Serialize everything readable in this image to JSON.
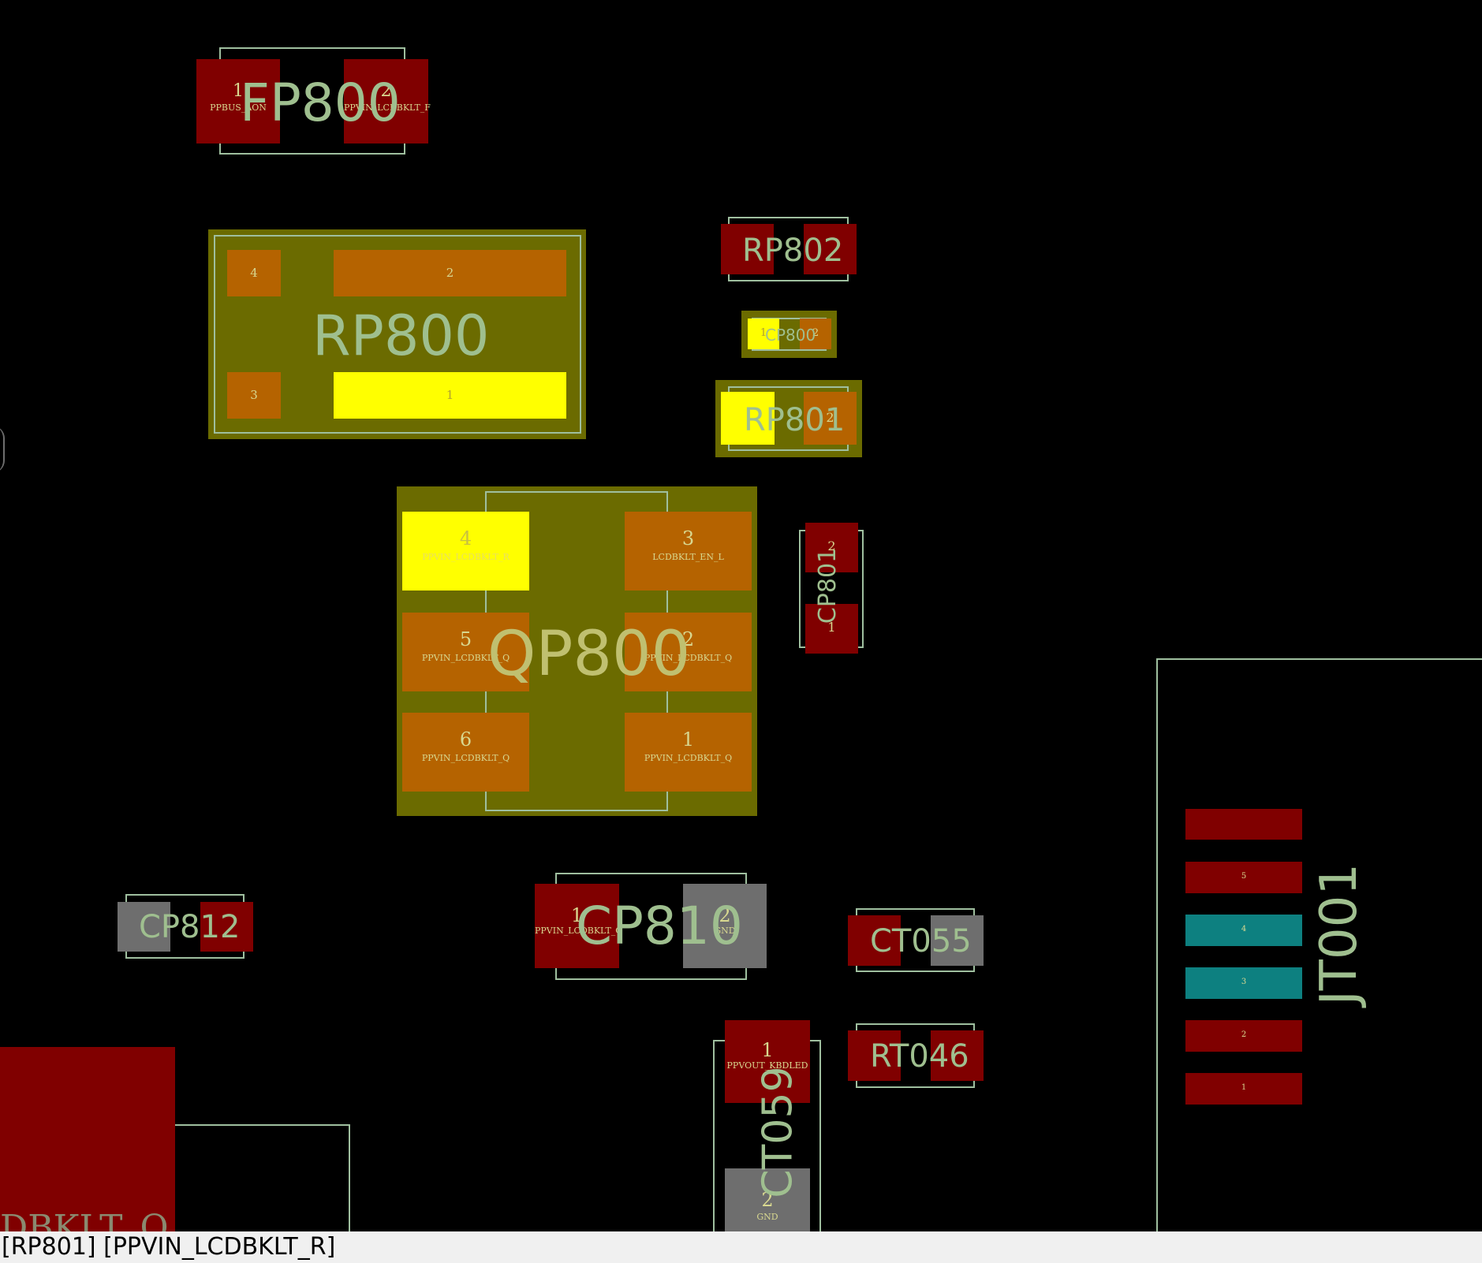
{
  "status_bar": {
    "text": "[RP801] [PPVIN_LCDBKLT_R]"
  },
  "colors": {
    "background": "#000000",
    "silkscreen": "#9fbf9f",
    "highlight": "#6b6b00",
    "pad_red": "#800000",
    "pad_orange": "#b56300",
    "pad_selected": "#ffff00",
    "pad_gnd": "#6e6e6e",
    "pad_teal": "#0d8080"
  },
  "components": {
    "fp800": {
      "ref": "FP800",
      "pins": [
        {
          "num": "1",
          "net": "PPBUS_AON"
        },
        {
          "num": "2",
          "net": "PPVIN_LCDBKLT_F"
        }
      ]
    },
    "rp800": {
      "ref": "RP800",
      "pins": [
        {
          "num": "1"
        },
        {
          "num": "2"
        },
        {
          "num": "3"
        },
        {
          "num": "4"
        }
      ]
    },
    "rp802": {
      "ref": "RP802"
    },
    "cp800": {
      "ref": "CP800",
      "pins": [
        {
          "num": "1"
        },
        {
          "num": "2"
        }
      ]
    },
    "rp801": {
      "ref": "RP801",
      "pins": [
        {
          "num": "2"
        }
      ]
    },
    "qp800": {
      "ref": "QP800",
      "pins": [
        {
          "num": "4",
          "net": "PPVIN_LCDBKLT_R"
        },
        {
          "num": "3",
          "net": "LCDBKLT_EN_L"
        },
        {
          "num": "5",
          "net": "PPVIN_LCDBKLT_Q"
        },
        {
          "num": "2",
          "net": "PPVIN_LCDBKLT_Q"
        },
        {
          "num": "6",
          "net": "PPVIN_LCDBKLT_Q"
        },
        {
          "num": "1",
          "net": "PPVIN_LCDBKLT_Q"
        }
      ]
    },
    "cp801": {
      "ref": "CP801",
      "pins": [
        {
          "num": "2"
        },
        {
          "num": "1"
        }
      ]
    },
    "cp812": {
      "ref": "CP812"
    },
    "cp810": {
      "ref": "CP810",
      "pins": [
        {
          "num": "1",
          "net": "PPVIN_LCDBKLT_Q"
        },
        {
          "num": "2",
          "net": "GND"
        }
      ]
    },
    "ct055": {
      "ref": "CT055"
    },
    "rt046": {
      "ref": "RT046"
    },
    "ct059": {
      "ref": "CT059",
      "pins": [
        {
          "num": "1",
          "net": "PPVOUT_KBDLED"
        },
        {
          "num": "2",
          "net": "GND"
        }
      ]
    },
    "jt001": {
      "ref": "JT001",
      "pins": [
        {
          "num": "5"
        },
        {
          "num": "4"
        },
        {
          "num": "3"
        },
        {
          "num": "2"
        },
        {
          "num": "1"
        }
      ]
    },
    "partial_left": {
      "label": "DBKLT_Q"
    }
  }
}
